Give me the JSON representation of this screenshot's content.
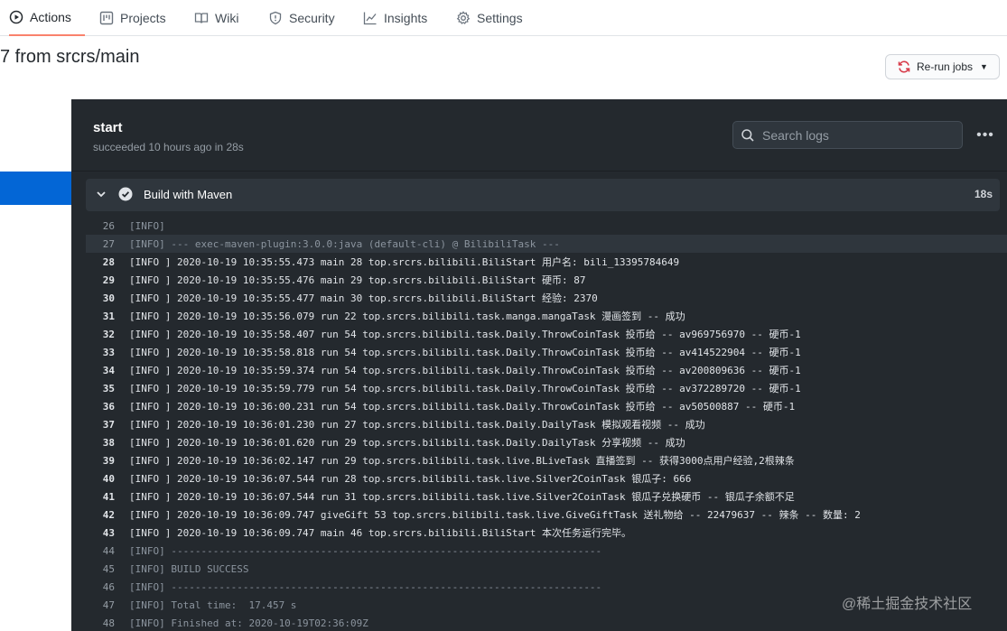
{
  "tabs": [
    {
      "label": "Actions",
      "icon": "play-icon"
    },
    {
      "label": "Projects",
      "icon": "project-icon"
    },
    {
      "label": "Wiki",
      "icon": "book-icon"
    },
    {
      "label": "Security",
      "icon": "shield-icon"
    },
    {
      "label": "Insights",
      "icon": "graph-icon"
    },
    {
      "label": "Settings",
      "icon": "gear-icon"
    }
  ],
  "run": {
    "title": "7 from srcrs/main",
    "rerun_label": "Re-run jobs"
  },
  "job": {
    "name": "start",
    "meta": "succeeded 10 hours ago in 28s",
    "search_placeholder": "Search logs"
  },
  "step": {
    "name": "Build with Maven",
    "duration": "18s"
  },
  "log_lines": [
    {
      "n": "26",
      "text": "[INFO]",
      "bright": false
    },
    {
      "n": "27",
      "text": "[INFO] --- exec-maven-plugin:3.0.0:java (default-cli) @ BilibiliTask ---",
      "bright": false
    },
    {
      "n": "28",
      "text": "[INFO ] 2020-10-19 10:35:55.473 main 28 top.srcrs.bilibili.BiliStart 用户名: bili_13395784649",
      "bright": true
    },
    {
      "n": "29",
      "text": "[INFO ] 2020-10-19 10:35:55.476 main 29 top.srcrs.bilibili.BiliStart 硬币: 87",
      "bright": true
    },
    {
      "n": "30",
      "text": "[INFO ] 2020-10-19 10:35:55.477 main 30 top.srcrs.bilibili.BiliStart 经验: 2370",
      "bright": true
    },
    {
      "n": "31",
      "text": "[INFO ] 2020-10-19 10:35:56.079 run 22 top.srcrs.bilibili.task.manga.mangaTask 漫画签到 -- 成功",
      "bright": true
    },
    {
      "n": "32",
      "text": "[INFO ] 2020-10-19 10:35:58.407 run 54 top.srcrs.bilibili.task.Daily.ThrowCoinTask 投币给 -- av969756970 -- 硬币-1",
      "bright": true
    },
    {
      "n": "33",
      "text": "[INFO ] 2020-10-19 10:35:58.818 run 54 top.srcrs.bilibili.task.Daily.ThrowCoinTask 投币给 -- av414522904 -- 硬币-1",
      "bright": true
    },
    {
      "n": "34",
      "text": "[INFO ] 2020-10-19 10:35:59.374 run 54 top.srcrs.bilibili.task.Daily.ThrowCoinTask 投币给 -- av200809636 -- 硬币-1",
      "bright": true
    },
    {
      "n": "35",
      "text": "[INFO ] 2020-10-19 10:35:59.779 run 54 top.srcrs.bilibili.task.Daily.ThrowCoinTask 投币给 -- av372289720 -- 硬币-1",
      "bright": true
    },
    {
      "n": "36",
      "text": "[INFO ] 2020-10-19 10:36:00.231 run 54 top.srcrs.bilibili.task.Daily.ThrowCoinTask 投币给 -- av50500887 -- 硬币-1",
      "bright": true
    },
    {
      "n": "37",
      "text": "[INFO ] 2020-10-19 10:36:01.230 run 27 top.srcrs.bilibili.task.Daily.DailyTask 模拟观看视频 -- 成功",
      "bright": true
    },
    {
      "n": "38",
      "text": "[INFO ] 2020-10-19 10:36:01.620 run 29 top.srcrs.bilibili.task.Daily.DailyTask 分享视频 -- 成功",
      "bright": true
    },
    {
      "n": "39",
      "text": "[INFO ] 2020-10-19 10:36:02.147 run 29 top.srcrs.bilibili.task.live.BLiveTask 直播签到 -- 获得3000点用户经验,2根辣条",
      "bright": true
    },
    {
      "n": "40",
      "text": "[INFO ] 2020-10-19 10:36:07.544 run 28 top.srcrs.bilibili.task.live.Silver2CoinTask 银瓜子: 666",
      "bright": true
    },
    {
      "n": "41",
      "text": "[INFO ] 2020-10-19 10:36:07.544 run 31 top.srcrs.bilibili.task.live.Silver2CoinTask 银瓜子兑换硬币 -- 银瓜子余额不足",
      "bright": true
    },
    {
      "n": "42",
      "text": "[INFO ] 2020-10-19 10:36:09.747 giveGift 53 top.srcrs.bilibili.task.live.GiveGiftTask 送礼物给 -- 22479637 -- 辣条 -- 数量: 2",
      "bright": true
    },
    {
      "n": "43",
      "text": "[INFO ] 2020-10-19 10:36:09.747 main 46 top.srcrs.bilibili.BiliStart 本次任务运行完毕。",
      "bright": true
    },
    {
      "n": "44",
      "text": "[INFO] ------------------------------------------------------------------------",
      "bright": false
    },
    {
      "n": "45",
      "text": "[INFO] BUILD SUCCESS",
      "bright": false
    },
    {
      "n": "46",
      "text": "[INFO] ------------------------------------------------------------------------",
      "bright": false
    },
    {
      "n": "47",
      "text": "[INFO] Total time:  17.457 s",
      "bright": false
    },
    {
      "n": "48",
      "text": "[INFO] Finished at: 2020-10-19T02:36:09Z",
      "bright": false
    }
  ],
  "watermark": "@稀土掘金技术社区",
  "colors": {
    "accent": "#0366d6",
    "active_tab_underline": "#f9826c",
    "log_bg": "#24292e",
    "rerun_icon": "#d73a49"
  }
}
